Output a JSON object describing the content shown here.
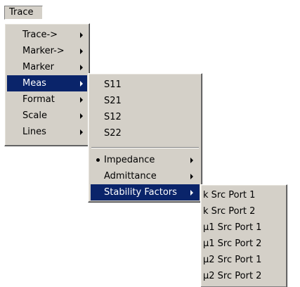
{
  "menubar": {
    "trace_label": "Trace"
  },
  "trace_menu": {
    "items": [
      {
        "label": "Trace->",
        "submenu": true
      },
      {
        "label": "Marker->",
        "submenu": true
      },
      {
        "label": "Marker",
        "submenu": true
      },
      {
        "label": "Meas",
        "submenu": true,
        "selected": true
      },
      {
        "label": "Format",
        "submenu": true
      },
      {
        "label": "Scale",
        "submenu": true
      },
      {
        "label": "Lines",
        "submenu": true
      }
    ]
  },
  "meas_menu": {
    "s_params": [
      "S11",
      "S21",
      "S12",
      "S22"
    ],
    "modes": [
      {
        "label": "Impedance",
        "submenu": true,
        "checked": true
      },
      {
        "label": "Admittance",
        "submenu": true
      },
      {
        "label": "Stability Factors",
        "submenu": true,
        "selected": true
      }
    ]
  },
  "stability_menu": {
    "items": [
      "k Src Port 1",
      "k Src Port 2",
      "μ1 Src Port 1",
      "μ1 Src Port 2",
      "μ2 Src Port 1",
      "μ2 Src Port 2"
    ]
  },
  "colors": {
    "menu_face": "#d4d0c8",
    "highlight": "#0a246a",
    "highlight_text": "#ffffff"
  }
}
